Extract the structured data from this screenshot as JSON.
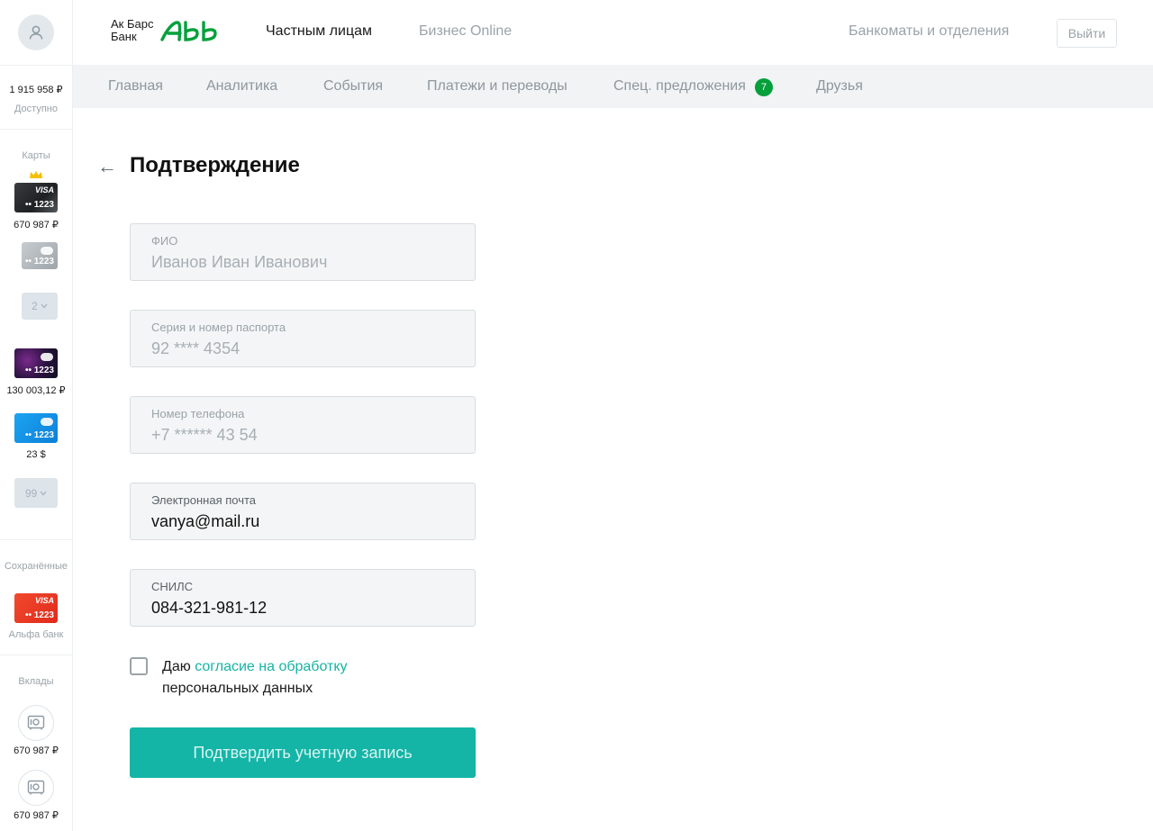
{
  "sidebar": {
    "balance": "1 915 958 ₽",
    "balance_caption": "Доступно",
    "cards_title": "Карты",
    "cards": [
      {
        "digits": "•• 1223",
        "brand": "VISA",
        "amount": "670 987 ₽"
      },
      {
        "digits": "•• 1223"
      },
      {
        "digits": "•• 1223",
        "amount": "130 003,12 ₽"
      },
      {
        "digits": "•• 1223",
        "amount": "23 $"
      }
    ],
    "stack_counts": [
      "2",
      "99"
    ],
    "saved_title": "Сохранённые",
    "saved_card": {
      "digits": "•• 1223",
      "brand": "VISA",
      "bank": "Альфа банк"
    },
    "deposits_title": "Вклады",
    "deposits": [
      {
        "amount": "670 987 ₽"
      },
      {
        "amount": "670 987 ₽"
      }
    ]
  },
  "header": {
    "logo_line1": "Ак Барс",
    "logo_line2": "Банк",
    "nav_links": [
      "Частным лицам",
      "Бизнес Online"
    ],
    "atm_link": "Банкоматы и отделения",
    "logout": "Выйти"
  },
  "navbar": {
    "items": [
      "Главная",
      "Аналитика",
      "События",
      "Платежи и переводы",
      "Спец. предложения",
      "Друзья"
    ],
    "offers_badge": "7"
  },
  "page": {
    "title": "Подтверждение",
    "fields": [
      {
        "label": "ФИО",
        "value": "Иванов Иван Иванович"
      },
      {
        "label": "Серия и номер паспорта",
        "value": "92 **** 4354"
      },
      {
        "label": "Номер телефона",
        "value": "+7 ****** 43 54"
      },
      {
        "label": "Электронная почта",
        "value": "vanya@mail.ru"
      },
      {
        "label": "СНИЛС",
        "value": "084-321-981-12"
      }
    ],
    "consent_prefix": "Даю ",
    "consent_link": "согласие на обработку",
    "consent_suffix": "персональных данных",
    "submit": "Подтвердить учетную запись"
  },
  "colors": {
    "accent": "#14b5a7",
    "brand_green": "#03a03c",
    "link": "#17b3a3"
  },
  "icons": [
    "user-icon",
    "crown-icon",
    "chevron-down-icon",
    "safe-icon",
    "back-arrow-icon"
  ]
}
